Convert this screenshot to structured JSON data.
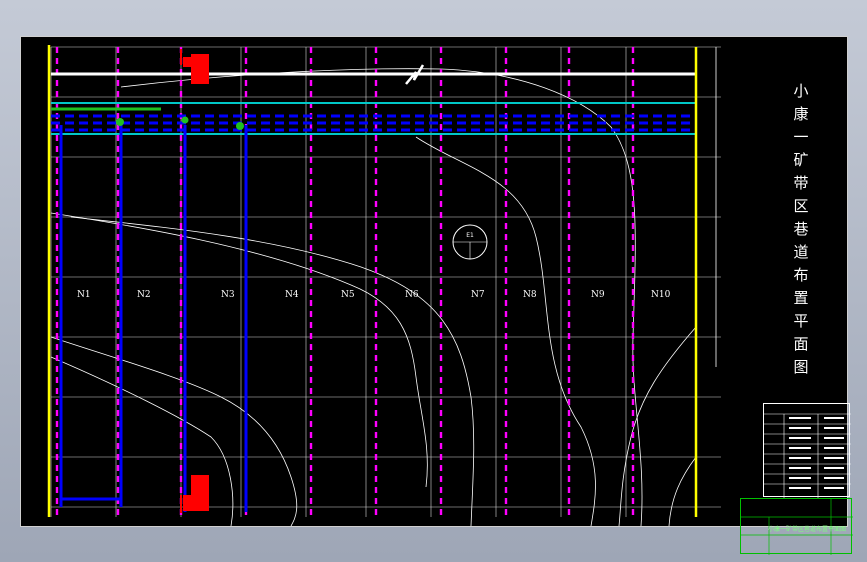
{
  "title": "小康一矿带区巷道布置平面图",
  "title_chars": [
    "小",
    "康",
    "一",
    "矿",
    "带",
    "区",
    "巷",
    "道",
    "布",
    "置",
    "平",
    "面",
    "图"
  ],
  "panels": [
    {
      "label": "N1"
    },
    {
      "label": "N2"
    },
    {
      "label": "N3"
    },
    {
      "label": "N4"
    },
    {
      "label": "N5"
    },
    {
      "label": "N6"
    },
    {
      "label": "N7"
    },
    {
      "label": "N8"
    },
    {
      "label": "N9"
    },
    {
      "label": "N10"
    }
  ],
  "borehole": {
    "id": "E1"
  },
  "title_block": {
    "text": "小康一矿带区巷道布置平面图"
  },
  "colors": {
    "background": "#000000",
    "grid": "#ffffff",
    "panel_boundary": "#ff00ff",
    "roadway": "#0000ff",
    "airway": "#00c8c8",
    "marker": "#ff0000",
    "boundary": "#ffff00",
    "title_block": "#00c000"
  }
}
